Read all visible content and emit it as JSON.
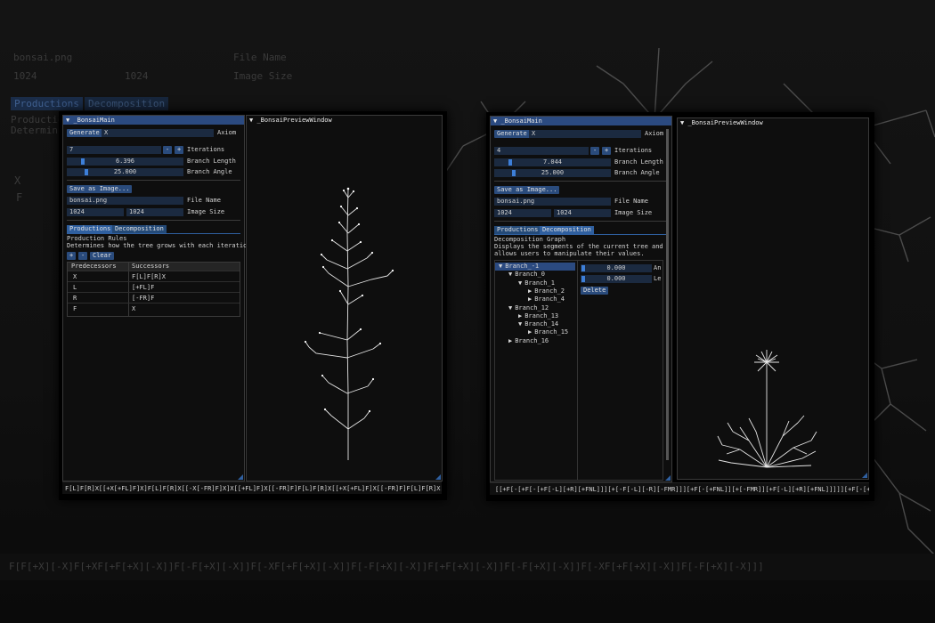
{
  "background": {
    "file_name_value": "bonsai.png",
    "file_name_label": "File Name",
    "size_w": "1024",
    "size_h": "1024",
    "size_label": "Image Size",
    "tab_productions": "Productions",
    "tab_decomposition": "Decomposition",
    "prod_title": "Production",
    "prod_desc": "Determin",
    "bottom_string": "F[F[+X][-X]F[+XF[+F[+X][-X]]F[-F[+X][-X]]F[-XF[+F[+X][-X]]F[-F[+X][-X]]F[+F[+X][-X]]F[-F[+X][-X]]F[-XF[+F[+X][-X]]F[-F[+X][-X]]]"
  },
  "left": {
    "main_title": "_BonsaiMain",
    "preview_title": "_BonsaiPreviewWindow",
    "generate": "Generate",
    "axiom_value": "X",
    "axiom_label": "Axiom",
    "iterations_value": "7",
    "iterations_label": "Iterations",
    "minus": "-",
    "plus": "+",
    "branch_length_value": "6.396",
    "branch_length_label": "Branch Length",
    "branch_angle_value": "25.000",
    "branch_angle_label": "Branch Angle",
    "save": "Save as Image...",
    "file_name_value": "bonsai.png",
    "file_name_label": "File Name",
    "size_w": "1024",
    "size_h": "1024",
    "size_label": "Image Size",
    "tab_productions": "Productions",
    "tab_decomposition": "Decomposition",
    "section_title": "Production Rules",
    "section_desc": "Determines how the tree grows with each iteration.",
    "add": "+",
    "remove": "-",
    "clear": "Clear",
    "col_pred": "Predecessors",
    "col_succ": "Successors",
    "rules": [
      {
        "pred": "X",
        "succ": "F[L]F[R]X"
      },
      {
        "pred": "L",
        "succ": "[+FL]F"
      },
      {
        "pred": "R",
        "succ": "[-FR]F"
      },
      {
        "pred": "F",
        "succ": "X"
      }
    ],
    "string": "F[L]F[R]X[[+X[+FL]F]X]F[L]F[R]X[[-X[-FR]F]X]X[[+FL]F]X[[-FR]F]F[L]F[R]X[[+X[+FL]F]X[[-FR]F]F[L]F[R]X[+FL]F[R]X"
  },
  "right": {
    "main_title": "_BonsaiMain",
    "preview_title": "_BonsaiPreviewWindow",
    "generate": "Generate",
    "axiom_value": "X",
    "axiom_label": "Axiom",
    "iterations_value": "4",
    "iterations_label": "Iterations",
    "minus": "-",
    "plus": "+",
    "branch_length_value": "7.044",
    "branch_length_label": "Branch Length",
    "branch_angle_value": "25.000",
    "branch_angle_label": "Branch Angle",
    "save": "Save as Image...",
    "file_name_value": "bonsai.png",
    "file_name_label": "File Name",
    "size_w": "1024",
    "size_h": "1024",
    "size_label": "Image Size",
    "tab_productions": "Productions",
    "tab_decomposition": "Decomposition",
    "section_title": "Decomposition Graph",
    "section_desc1": "Displays the segments of the current tree and",
    "section_desc2": "allows users to manipulate their values.",
    "tree": [
      {
        "label": "Branch_-1",
        "level": 0,
        "arrow": "▼",
        "selected": true
      },
      {
        "label": "Branch_0",
        "level": 1,
        "arrow": "▼"
      },
      {
        "label": "Branch_1",
        "level": 2,
        "arrow": "▼"
      },
      {
        "label": "Branch_2",
        "level": 3,
        "arrow": "▶"
      },
      {
        "label": "Branch_4",
        "level": 3,
        "arrow": "▶"
      },
      {
        "label": "Branch_12",
        "level": 1,
        "arrow": "▼"
      },
      {
        "label": "Branch_13",
        "level": 2,
        "arrow": "▶"
      },
      {
        "label": "Branch_14",
        "level": 2,
        "arrow": "▼"
      },
      {
        "label": "Branch_15",
        "level": 3,
        "arrow": "▶"
      },
      {
        "label": "Branch_16",
        "level": 1,
        "arrow": "▶"
      }
    ],
    "val1": "0.000",
    "val1_label": "An",
    "val2": "0.000",
    "val2_label": "Le",
    "delete": "Delete",
    "string": "[[+F[-[+F[-[+F[-L][+R][+FNL]]][+[-F[-L][-R][-FMR]]][+F[-[+FNL]][+[-FMR]][+F[-L][+R][+FNL]]]]][+F[-[+F[-L][+"
  }
}
